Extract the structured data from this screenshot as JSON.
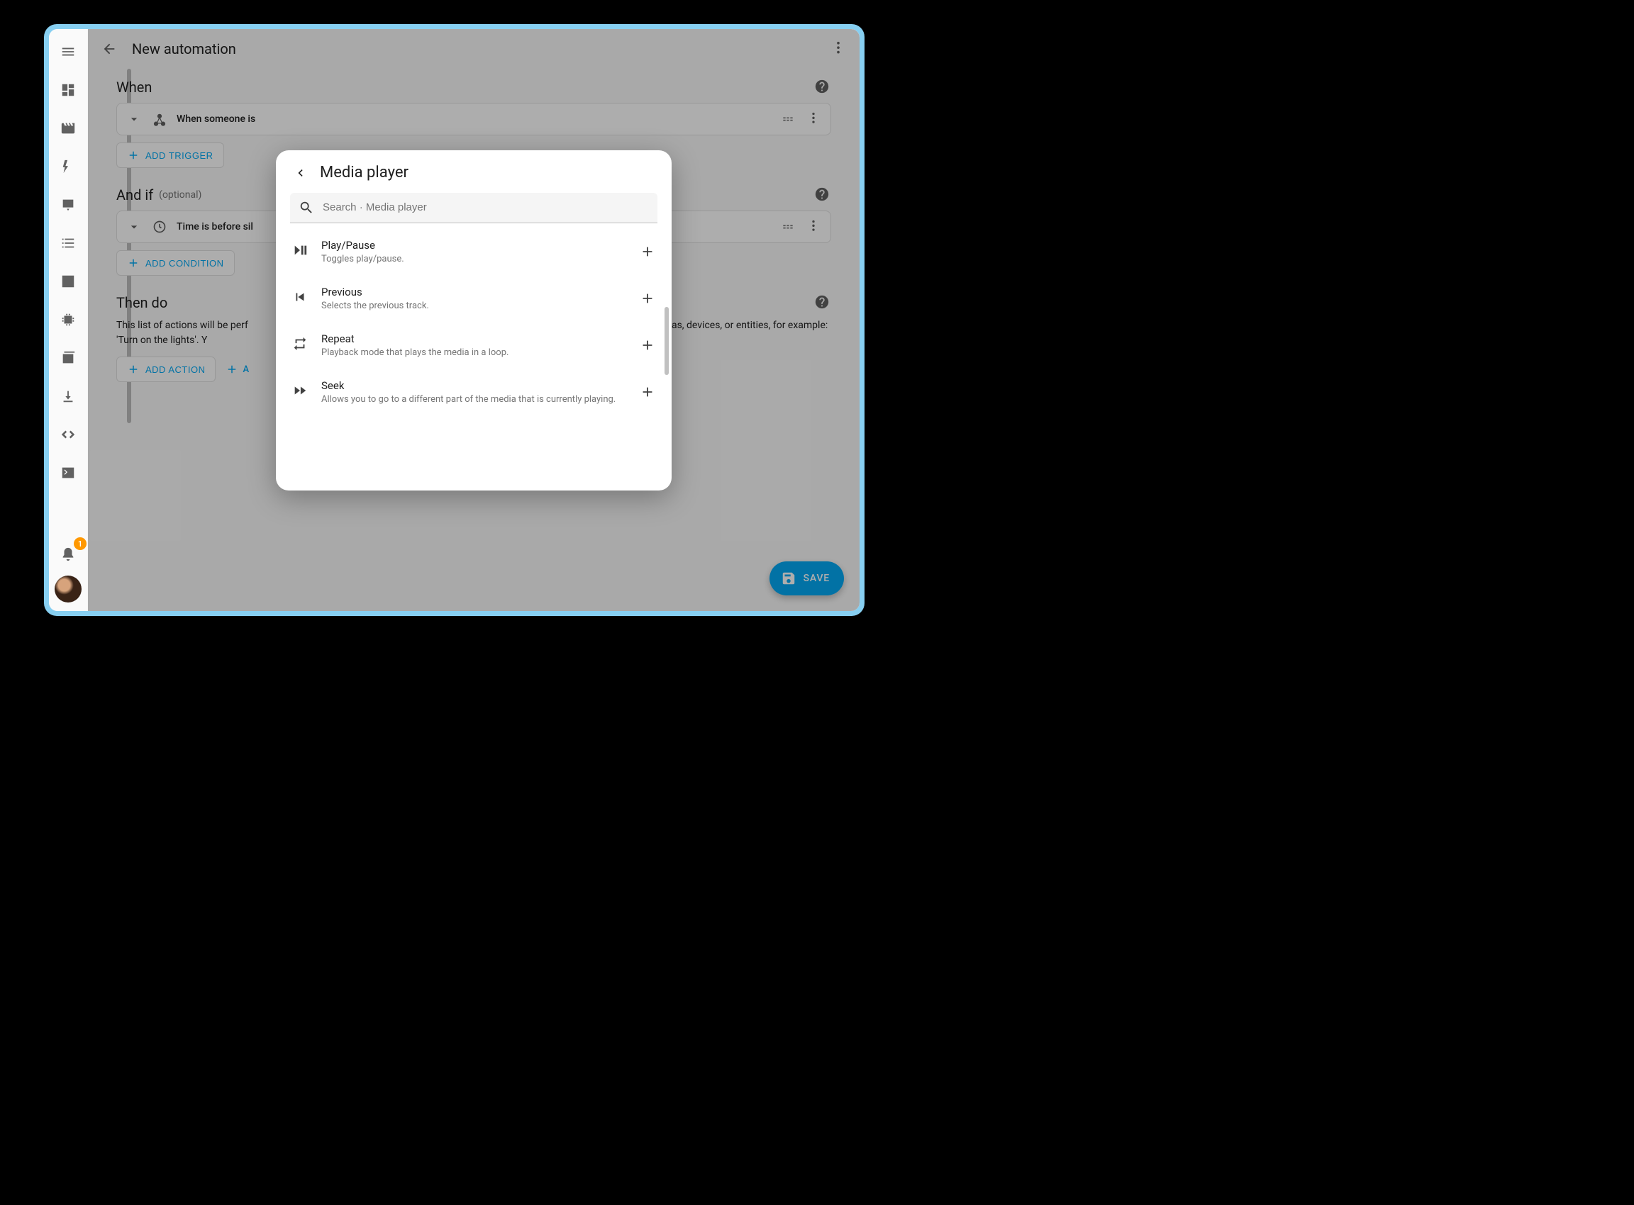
{
  "header": {
    "title": "New automation"
  },
  "sections": {
    "when": {
      "title": "When",
      "trigger_summary": "When someone is",
      "add_trigger": "Add Trigger"
    },
    "andif": {
      "title": "And if",
      "optional": "(optional)",
      "condition_summary": "Time is before sil",
      "add_condition": "Add Condition"
    },
    "thendo": {
      "title": "Then do",
      "description_a": "This list of actions will be perf",
      "description_b": "your areas, devices, or entities, for example: 'Turn on the lights'. Y",
      "add_action": "Add Action",
      "second_btn": "A"
    }
  },
  "fab": {
    "label": "SAVE"
  },
  "notif_badge": "1",
  "dialog": {
    "title": "Media player",
    "search_placeholder": "Search · Media player",
    "items": [
      {
        "name": "Play/Pause",
        "desc": "Toggles play/pause.",
        "icon": "play-pause"
      },
      {
        "name": "Previous",
        "desc": "Selects the previous track.",
        "icon": "skip-previous"
      },
      {
        "name": "Repeat",
        "desc": "Playback mode that plays the media in a loop.",
        "icon": "repeat"
      },
      {
        "name": "Seek",
        "desc": "Allows you to go to a different part of the media that is currently playing.",
        "icon": "fast-forward"
      }
    ]
  }
}
